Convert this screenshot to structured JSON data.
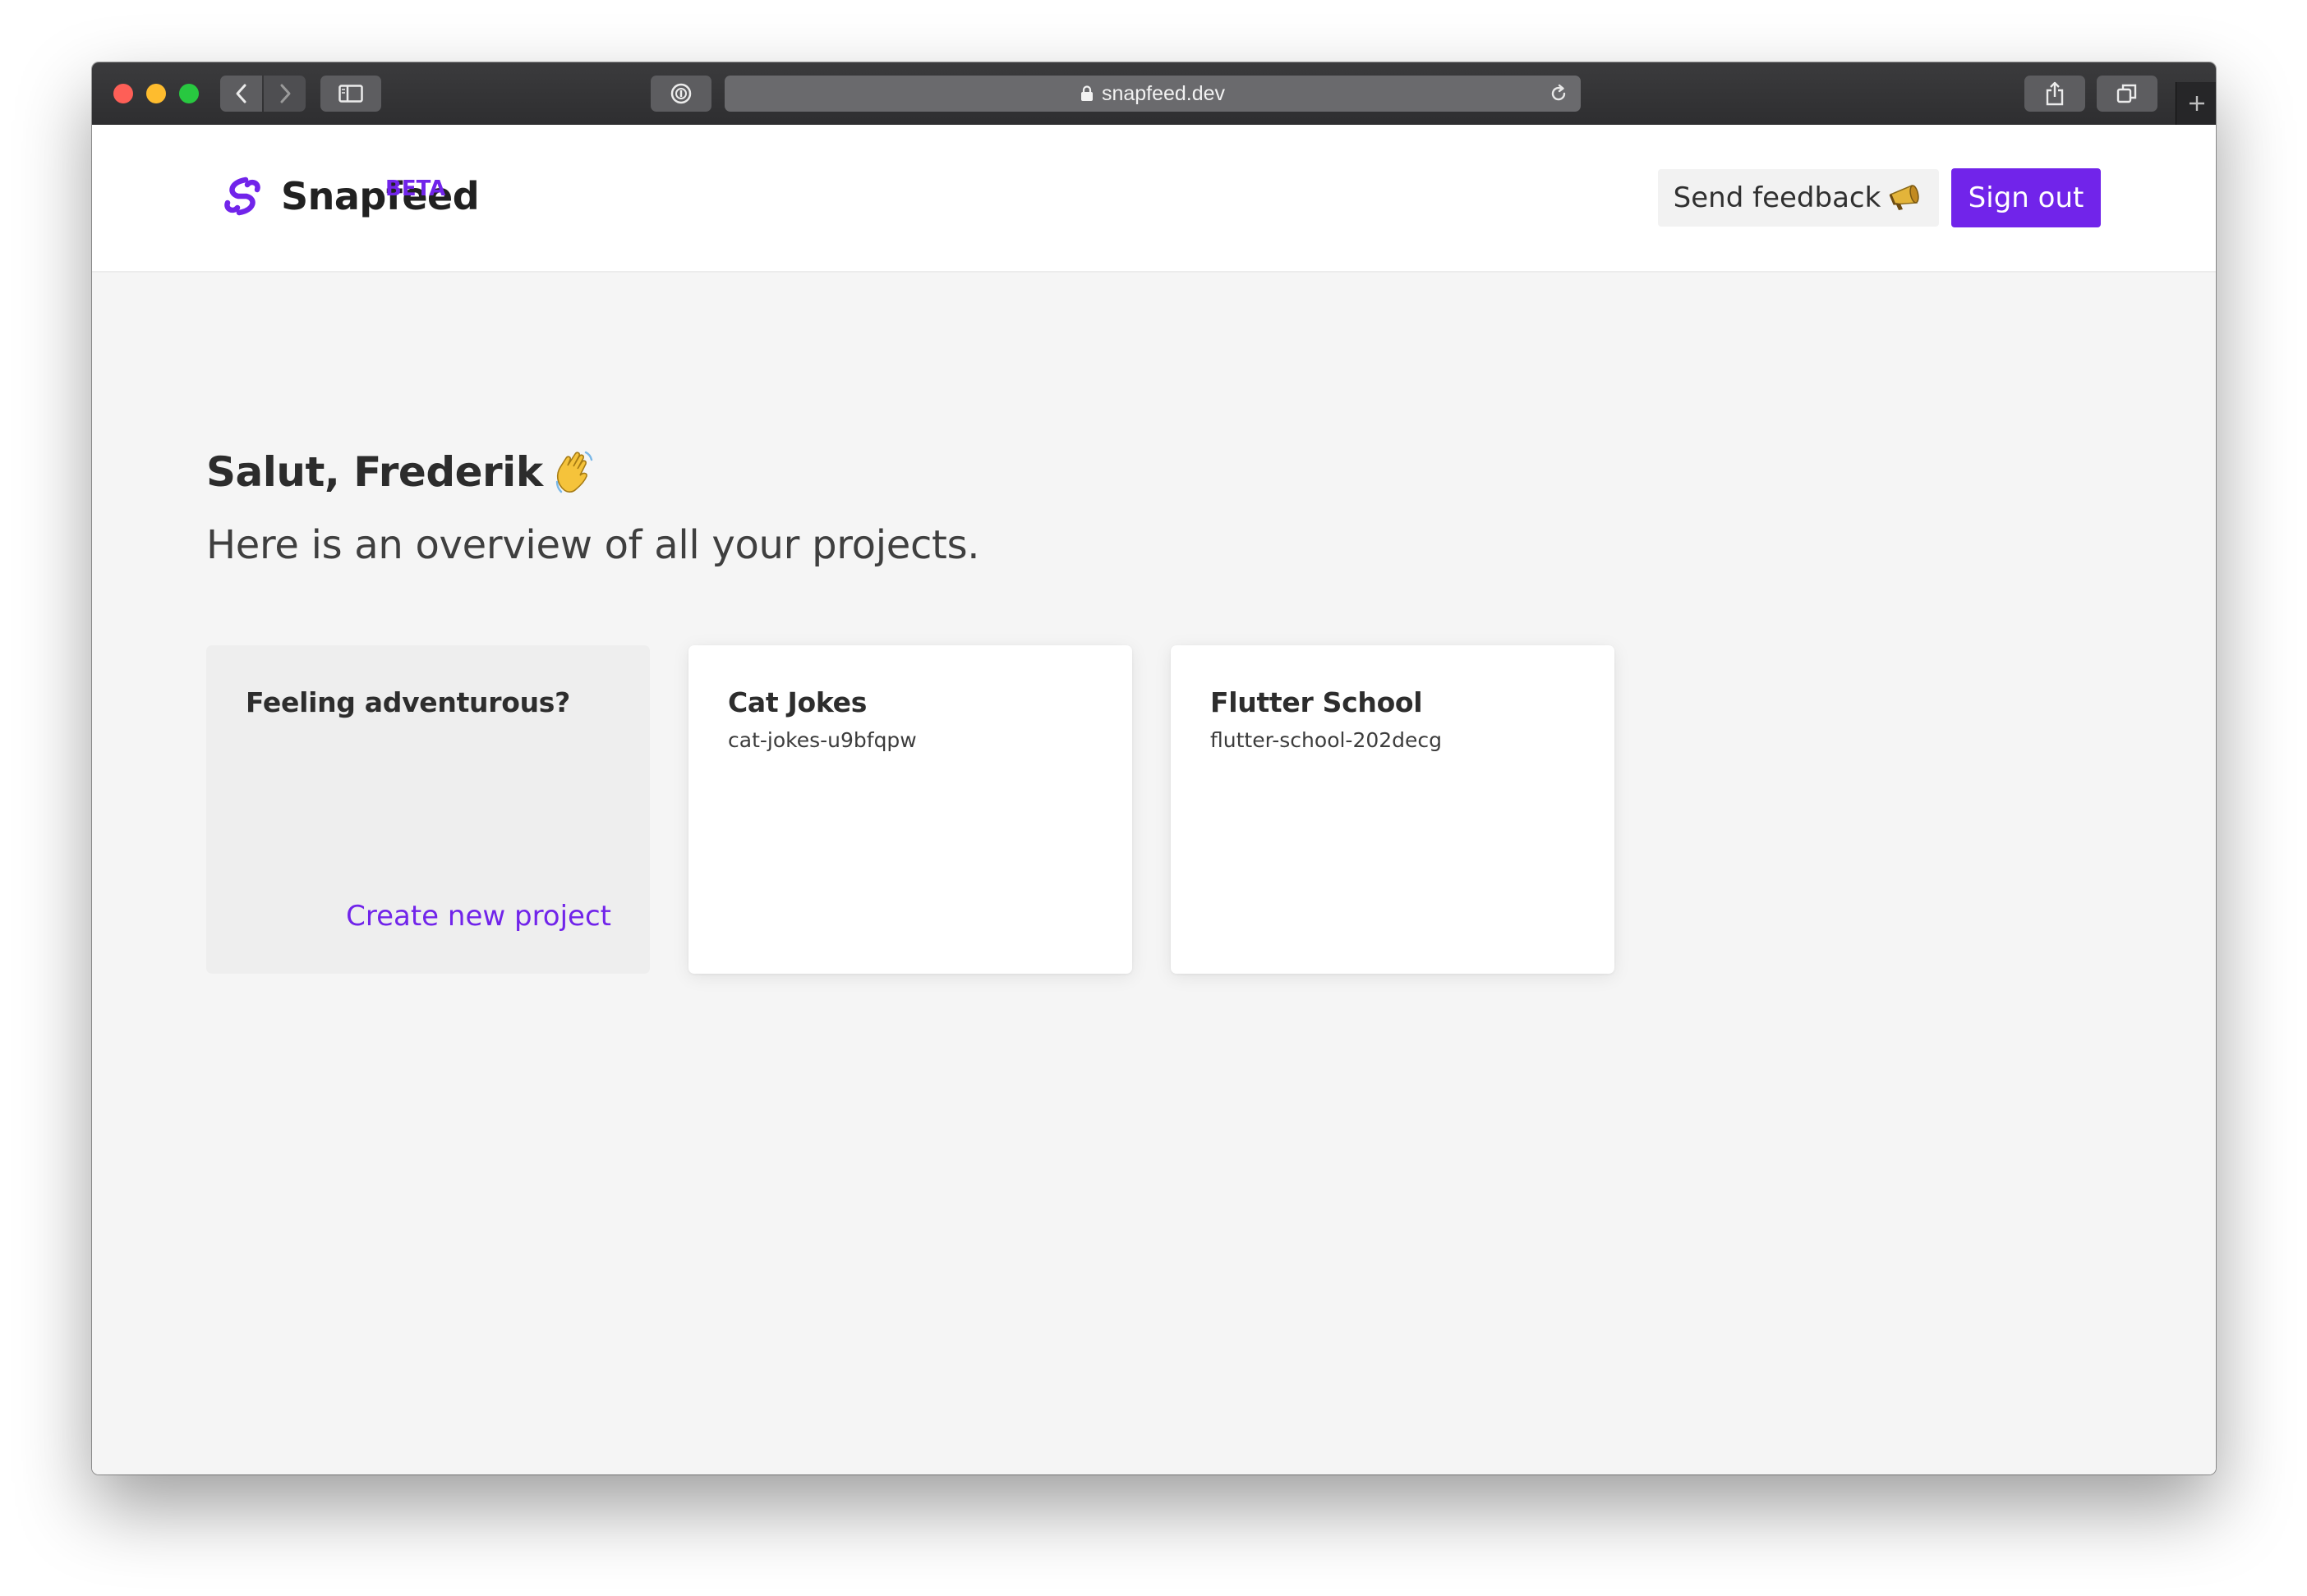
{
  "browser": {
    "url": "snapfeed.dev",
    "icons": {
      "back": "chevron-left-icon",
      "forward": "chevron-right-icon",
      "sidebar": "sidebar-icon",
      "privacy": "password-manager-icon",
      "lock": "lock-icon",
      "reload": "reload-icon",
      "share": "share-icon",
      "tabs": "tabs-overview-icon",
      "new_tab": "plus-icon"
    }
  },
  "header": {
    "brand": "Snapfeed",
    "badge": "BETA",
    "feedback_label": "Send feedback",
    "feedback_emoji": "📣",
    "signout_label": "Sign out"
  },
  "main": {
    "greeting": "Salut, Frederik",
    "greeting_emoji": "👋",
    "subtitle": "Here is an overview of all your projects."
  },
  "create_card": {
    "title": "Feeling adventurous?",
    "link": "Create new project"
  },
  "projects": [
    {
      "name": "Cat Jokes",
      "slug": "cat-jokes-u9bfqpw"
    },
    {
      "name": "Flutter School",
      "slug": "flutter-school-202decg"
    }
  ],
  "colors": {
    "accent": "#7124ea",
    "page_background": "#f5f5f5",
    "header_background": "#ffffff",
    "text": "#2c2c2c"
  }
}
